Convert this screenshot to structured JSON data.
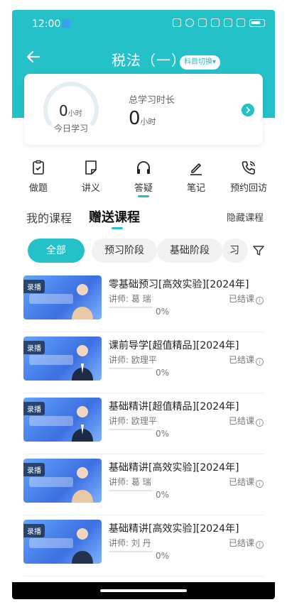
{
  "status": {
    "time": "12:00"
  },
  "header": {
    "title": "税法（一）",
    "subject_switch": "科目切换▾"
  },
  "study": {
    "today_value": "0",
    "today_unit": "小时",
    "today_label": "今日学习",
    "total_label": "总学习时长",
    "total_value": "0",
    "total_unit": "小时"
  },
  "quick": [
    {
      "label": "做题",
      "icon": "clipboard-icon"
    },
    {
      "label": "讲义",
      "icon": "note-icon"
    },
    {
      "label": "答疑",
      "icon": "headphones-icon"
    },
    {
      "label": "笔记",
      "icon": "pen-icon"
    },
    {
      "label": "预约回访",
      "icon": "phone-icon"
    }
  ],
  "tabs": {
    "mine": "我的课程",
    "gift": "赠送课程",
    "hide": "隐藏课程"
  },
  "filters": [
    "全部",
    "预习阶段",
    "基础阶段",
    "习"
  ],
  "courses": [
    {
      "tag": "录播",
      "title": "零基础预习[高效实验][2024年]",
      "teacher": "讲师:  葛   瑞",
      "status": "已结课",
      "progress": "0%"
    },
    {
      "tag": "录播",
      "title": "课前导学[超值精品][2024年]",
      "teacher": "讲师:  欧理平",
      "status": "已结课",
      "progress": "0%"
    },
    {
      "tag": "录播",
      "title": "基础精讲[超值精品][2024年]",
      "teacher": "讲师:  欧理平",
      "status": "已结课",
      "progress": "0%"
    },
    {
      "tag": "录播",
      "title": "基础精讲[高效实验][2024年]",
      "teacher": "讲师:  葛   瑞",
      "status": "已结课",
      "progress": "0%"
    },
    {
      "tag": "录播",
      "title": "基础精讲[高效实验][2024年]",
      "teacher": "讲师:  刘   丹",
      "status": "已结课",
      "progress": "0%"
    }
  ],
  "colors": {
    "accent": "#24c1c8"
  }
}
